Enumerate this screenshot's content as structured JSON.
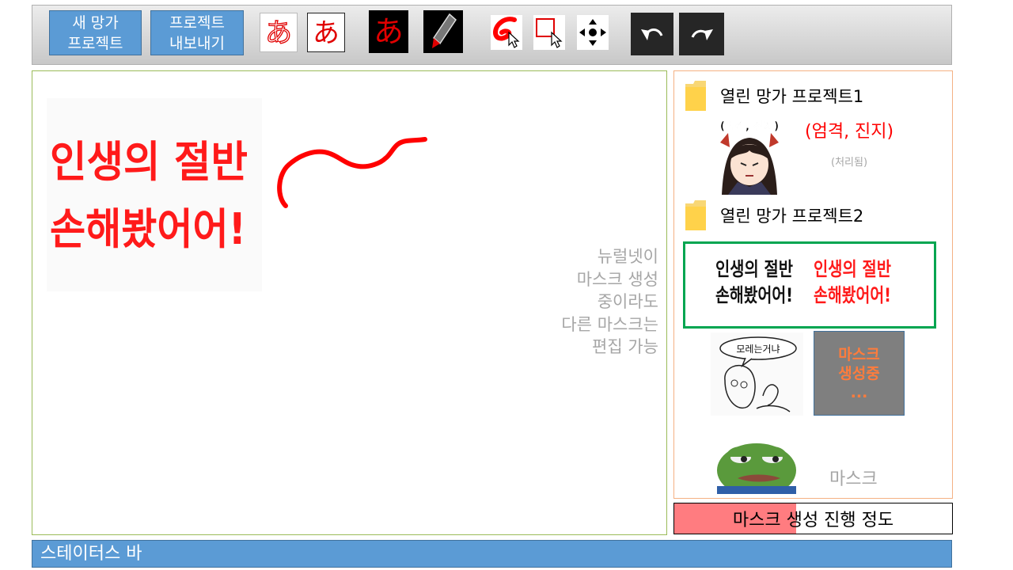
{
  "toolbar": {
    "new_project": {
      "line1": "새 망가",
      "line2": "프로젝트"
    },
    "export_project": {
      "line1": "프로젝트",
      "line2": "내보내기"
    },
    "glyph": "あ"
  },
  "canvas": {
    "text": {
      "line1": "인생의 절반",
      "line2": "손해봤어어!"
    },
    "note_lines": [
      "뉴럴넷이",
      "마스크 생성",
      "중이라도",
      "다른 마스크는",
      "편집 가능"
    ]
  },
  "panel": {
    "projects": [
      {
        "title": "열린 망가 프로젝트1",
        "items": [
          {
            "caption": "(엄격, 진지)",
            "label": "(엄격, 진지)",
            "status": "(처리됨)"
          }
        ]
      },
      {
        "title": "열린 망가 프로젝트2",
        "selected_item": {
          "text_line1": "인생의 절반",
          "text_line2": "손해봤어어!"
        },
        "items": [
          {
            "bubble": "모레는거냐"
          },
          {
            "overlay": {
              "line1": "마스크",
              "line2": "생성중",
              "line3": "..."
            }
          },
          {
            "label": "마스크"
          }
        ]
      }
    ]
  },
  "progress": {
    "label": "마스크 생성 진행 정도",
    "fraction": 0.44
  },
  "status": {
    "text": "스테이터스 바"
  },
  "colors": {
    "accent_blue": "#5b9bd5",
    "brush_red": "#ff0000",
    "selection_green": "#00a550",
    "progress_fill": "#ff7c80",
    "mask_overlay": "#7f7f7f",
    "mask_overlay_text": "#ff7c3c"
  },
  "icons": [
    "text-outline-icon",
    "text-filled-icon",
    "text-inverted-icon",
    "pencil-icon",
    "brush-select-icon",
    "rect-select-icon",
    "move-icon",
    "undo-icon",
    "redo-icon",
    "folder-icon"
  ]
}
